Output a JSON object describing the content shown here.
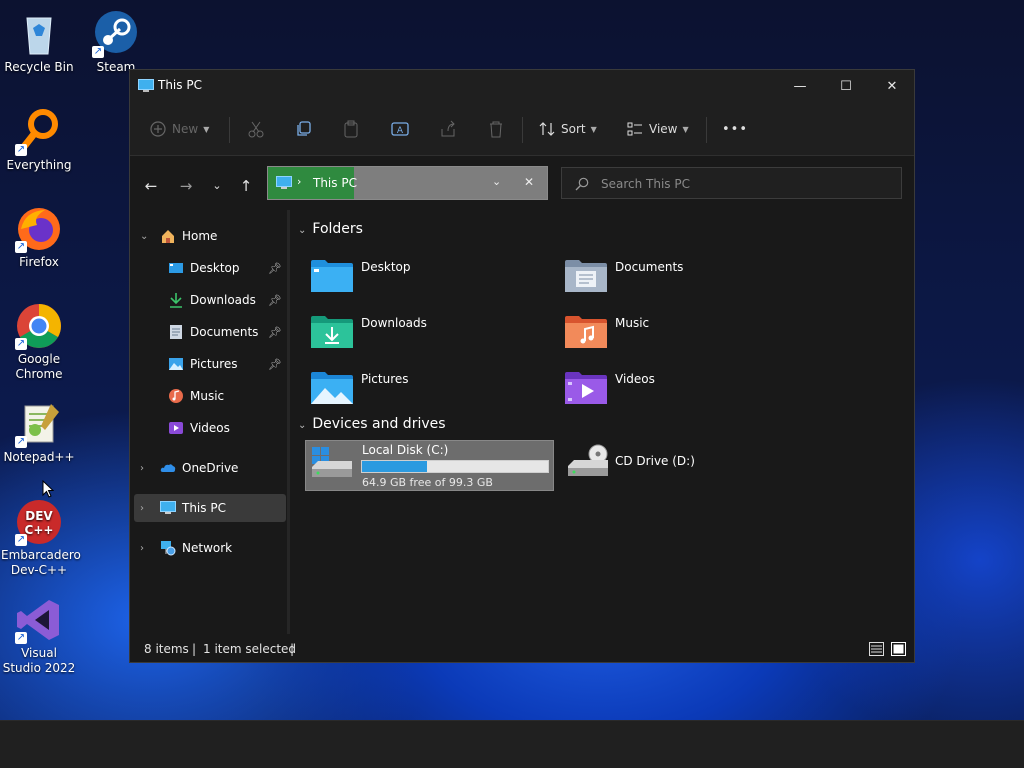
{
  "desktop": {
    "icons": [
      {
        "label": "Recycle Bin"
      },
      {
        "label": "Steam"
      },
      {
        "label": "Everything"
      },
      {
        "label": "Firefox"
      },
      {
        "label": "Google Chrome"
      },
      {
        "label": "Notepad++"
      },
      {
        "label": "Embarcadero Dev-C++"
      },
      {
        "label": "Visual Studio 2022"
      }
    ]
  },
  "window": {
    "title": "This PC",
    "controls": {
      "minimize": "—",
      "maximize": "☐",
      "close": "✕"
    }
  },
  "toolbar": {
    "new_label": "New",
    "sort_label": "Sort",
    "view_label": "View",
    "more_label": "•••"
  },
  "nav": {
    "address_text": "This PC",
    "search_placeholder": "Search This PC"
  },
  "sidebar": {
    "items": [
      {
        "label": "Home"
      },
      {
        "label": "Desktop"
      },
      {
        "label": "Downloads"
      },
      {
        "label": "Documents"
      },
      {
        "label": "Pictures"
      },
      {
        "label": "Music"
      },
      {
        "label": "Videos"
      },
      {
        "label": "OneDrive"
      },
      {
        "label": "This PC"
      },
      {
        "label": "Network"
      }
    ]
  },
  "content": {
    "folders_heading": "Folders",
    "folders": [
      {
        "label": "Desktop"
      },
      {
        "label": "Documents"
      },
      {
        "label": "Downloads"
      },
      {
        "label": "Music"
      },
      {
        "label": "Pictures"
      },
      {
        "label": "Videos"
      }
    ],
    "devices_heading": "Devices and drives",
    "drives": [
      {
        "label": "Local Disk (C:)",
        "free_text": "64.9 GB free of 99.3 GB",
        "used_fraction": 0.35
      },
      {
        "label": "CD Drive (D:)"
      }
    ]
  },
  "status": {
    "items": "8 items",
    "selected": "1 item selected"
  },
  "colors": {
    "accent": "#2b9ae0",
    "address_highlight": "#2f8a3f",
    "window_bg": "#191919"
  }
}
